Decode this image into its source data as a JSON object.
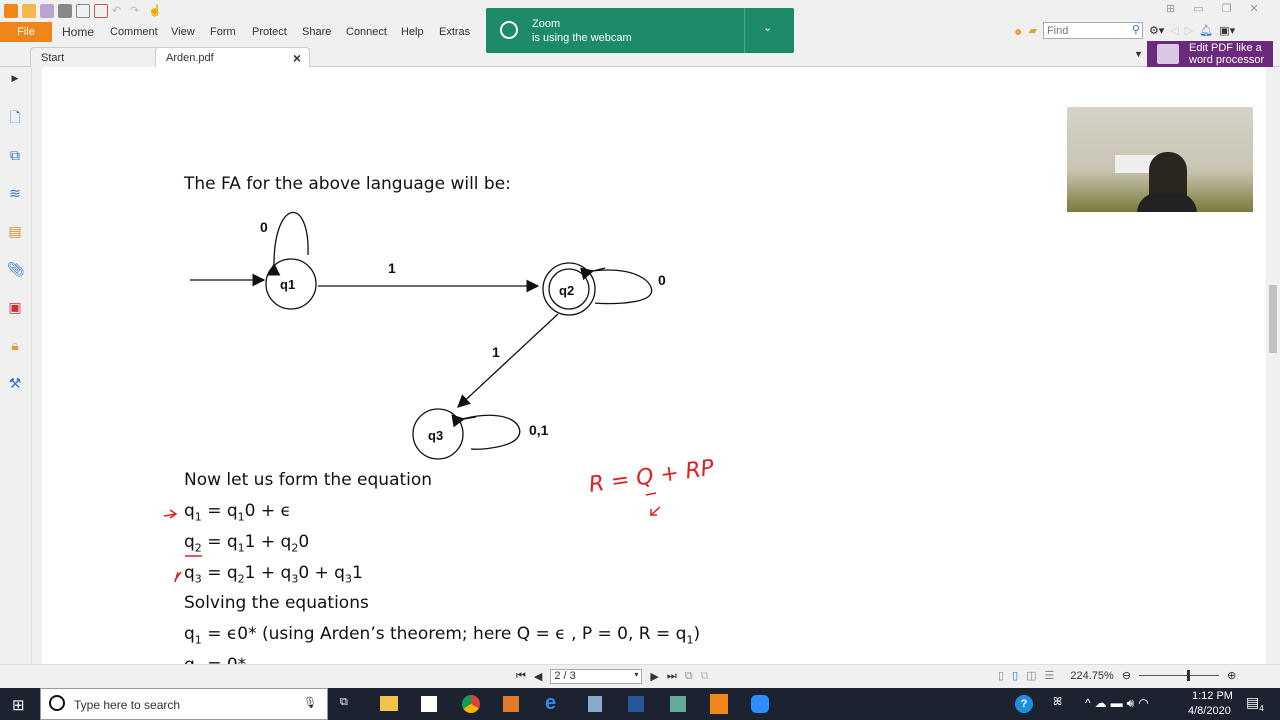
{
  "menu": {
    "file": "File",
    "items": [
      "Home",
      "Comment",
      "View",
      "Form",
      "Protect",
      "Share",
      "Connect",
      "Help",
      "Extras"
    ]
  },
  "tabs": [
    {
      "label": "Start"
    },
    {
      "label": "Arden.pdf",
      "close": "×"
    }
  ],
  "find": {
    "placeholder": "Find"
  },
  "promo": {
    "line1": "Edit PDF like a",
    "line2": "word processor"
  },
  "notification": {
    "title": "Zoom",
    "text": "is using the webcam"
  },
  "document": {
    "heading": "The FA for the above language will be:",
    "diagram": {
      "states": [
        "q1",
        "q2",
        "q3"
      ],
      "labels": {
        "q1_loop": "0",
        "q1_q2": "1",
        "q2_loop": "0",
        "q2_q3": "1",
        "q3_loop": "0,1"
      }
    },
    "form_eq": "Now let us form the equation",
    "solving": "Solving the equations",
    "annotation": "R = Q + RP"
  },
  "status": {
    "page": "2 / 3",
    "zoom": "224.75%"
  },
  "taskbar": {
    "search_placeholder": "Type here to search",
    "time": "1:12 PM",
    "date": "4/8/2020",
    "notifications": "4"
  }
}
